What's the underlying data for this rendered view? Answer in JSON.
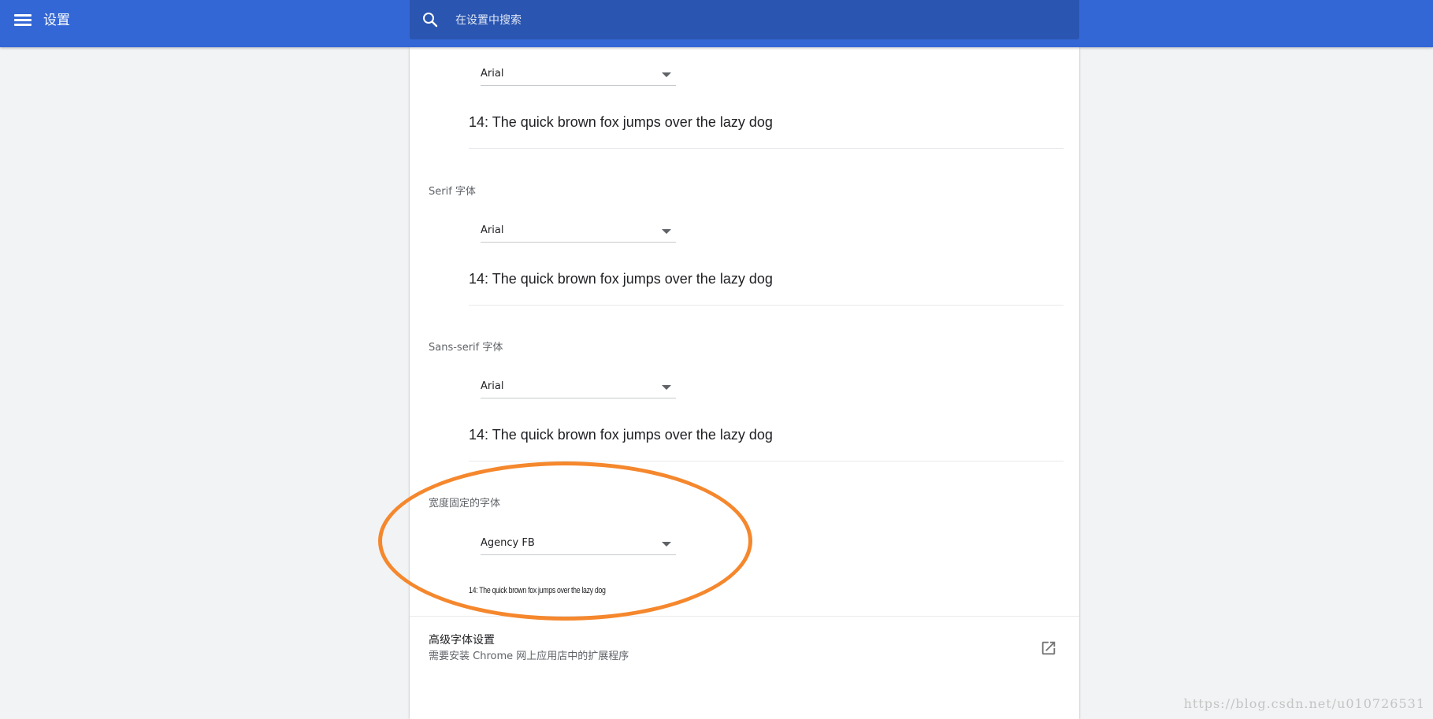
{
  "header": {
    "title": "设置",
    "menu_icon": "hamburger-menu-icon",
    "search_icon": "search-icon",
    "search_placeholder": "在设置中搜索",
    "search_value": ""
  },
  "fonts": {
    "standard": {
      "selected": "Arial",
      "sample": "14: The quick brown fox jumps over the lazy dog"
    },
    "serif": {
      "label": "Serif 字体",
      "selected": "Arial",
      "sample": "14: The quick brown fox jumps over the lazy dog"
    },
    "sans_serif": {
      "label": "Sans-serif 字体",
      "selected": "Arial",
      "sample": "14: The quick brown fox jumps over the lazy dog"
    },
    "fixed_width": {
      "label": "宽度固定的字体",
      "selected": "Agency FB",
      "sample": "14: The quick brown fox jumps over the lazy dog"
    }
  },
  "advanced": {
    "title": "高级字体设置",
    "subtitle": "需要安装 Chrome 网上应用店中的扩展程序",
    "icon": "open-in-new-icon"
  },
  "annotation": {
    "color": "#f5872d"
  },
  "watermark": "https://blog.csdn.net/u010726531",
  "colors": {
    "topbar": "#3367d6",
    "search_box": "#2a55b0",
    "background": "#f1f3f4"
  }
}
